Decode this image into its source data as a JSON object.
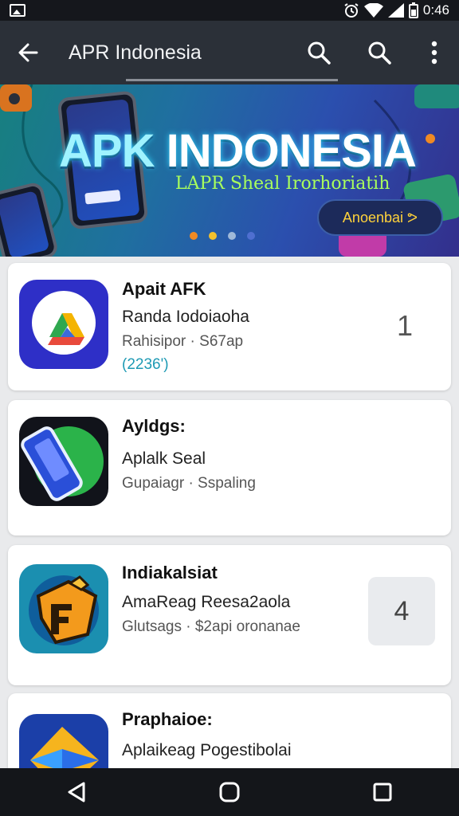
{
  "status_bar": {
    "time": "0:46"
  },
  "app_bar": {
    "title": "APR Indonesia"
  },
  "banner": {
    "title_apk": "APK",
    "title_rest": " INDONESIA",
    "subtitle": "LAPR Sheal Irorhoriatih",
    "button_label": "Anoenbai ᕗ",
    "dot_colors": [
      "#f08a24",
      "#f2c12e",
      "#9fb9d9",
      "#4f6fd0"
    ]
  },
  "apps": [
    {
      "title": "Apait AFK",
      "subtitle": "Randa Iodoiaoha",
      "meta": "Rahisipor · S67ap",
      "extra": "(2236')",
      "rank": "1"
    },
    {
      "title": "Ayldgs:",
      "subtitle": "Aplalk Seal",
      "meta": "Gupaiagr · Sspaling",
      "extra": "",
      "rank": ""
    },
    {
      "title": "Indiakalsiat",
      "subtitle": "AmaReag Reesa2aola",
      "meta": "Glutsags · $2api oronanae",
      "extra": "",
      "rank": "4"
    },
    {
      "title": "Praphaioe:",
      "subtitle": "Aplaikeag Pogestibolai",
      "meta": "",
      "extra": "",
      "rank": ""
    }
  ],
  "colors": {
    "app_bar": "#2b3038",
    "accent_link": "#1e9ab4",
    "banner_subtitle": "#a9ff5c"
  }
}
